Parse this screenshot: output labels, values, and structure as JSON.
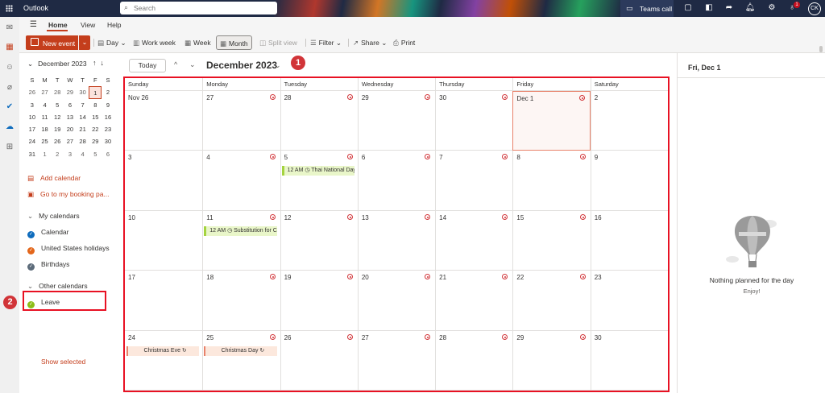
{
  "app": {
    "name": "Outlook"
  },
  "search": {
    "placeholder": "Search"
  },
  "topbar": {
    "teams_label": "Teams call",
    "notification_count": "1",
    "avatar_initials": "CK"
  },
  "ribbon": {
    "tabs": [
      "Home",
      "View",
      "Help"
    ],
    "new_event": "New event",
    "day": "Day",
    "work_week": "Work week",
    "week": "Week",
    "month": "Month",
    "split_view": "Split view",
    "filter": "Filter",
    "share": "Share",
    "print": "Print"
  },
  "minical": {
    "title": "December 2023",
    "weekdays": [
      "S",
      "M",
      "T",
      "W",
      "T",
      "F",
      "S"
    ],
    "weeks": [
      [
        "26",
        "27",
        "28",
        "29",
        "30",
        "1",
        "2"
      ],
      [
        "3",
        "4",
        "5",
        "6",
        "7",
        "8",
        "9"
      ],
      [
        "10",
        "11",
        "12",
        "13",
        "14",
        "15",
        "16"
      ],
      [
        "17",
        "18",
        "19",
        "20",
        "21",
        "22",
        "23"
      ],
      [
        "24",
        "25",
        "26",
        "27",
        "28",
        "29",
        "30"
      ],
      [
        "31",
        "1",
        "2",
        "3",
        "4",
        "5",
        "6"
      ]
    ]
  },
  "sidebar": {
    "add_calendar": "Add calendar",
    "booking_page": "Go to my booking pa...",
    "my_calendars": "My calendars",
    "calendars": [
      {
        "label": "Calendar",
        "color": "#0f6cbd"
      },
      {
        "label": "United States holidays",
        "color": "#e3661a"
      },
      {
        "label": "Birthdays",
        "color": "#5c6b7a"
      }
    ],
    "other_calendars": "Other calendars",
    "leave": {
      "label": "Leave",
      "color": "#8cbd18"
    },
    "show_selected": "Show selected"
  },
  "callouts": [
    "1",
    "2"
  ],
  "main": {
    "today": "Today",
    "month_title": "December 2023",
    "days_of_week": [
      "Sunday",
      "Monday",
      "Tuesday",
      "Wednesday",
      "Thursday",
      "Friday",
      "Saturday"
    ],
    "weeks": [
      [
        "Nov 26",
        "27",
        "28",
        "29",
        "30",
        "Dec 1",
        "2"
      ],
      [
        "3",
        "4",
        "5",
        "6",
        "7",
        "8",
        "9"
      ],
      [
        "10",
        "11",
        "12",
        "13",
        "14",
        "15",
        "16"
      ],
      [
        "17",
        "18",
        "19",
        "20",
        "21",
        "22",
        "23"
      ],
      [
        "24",
        "25",
        "26",
        "27",
        "28",
        "29",
        "30"
      ]
    ],
    "events": [
      {
        "label": "12 AM ◷ Thai National Day"
      },
      {
        "label": "12 AM ◷ Substitution for C"
      },
      {
        "label": "Christmas Eve ↻"
      },
      {
        "label": "Christmas Day ↻"
      }
    ]
  },
  "right_pane": {
    "title": "Fri, Dec 1",
    "empty_title": "Nothing planned for the day",
    "empty_sub": "Enjoy!"
  },
  "colors": {
    "accent": "#c43e1c",
    "highlight_box": "#e81123",
    "callout": "#d13438"
  }
}
